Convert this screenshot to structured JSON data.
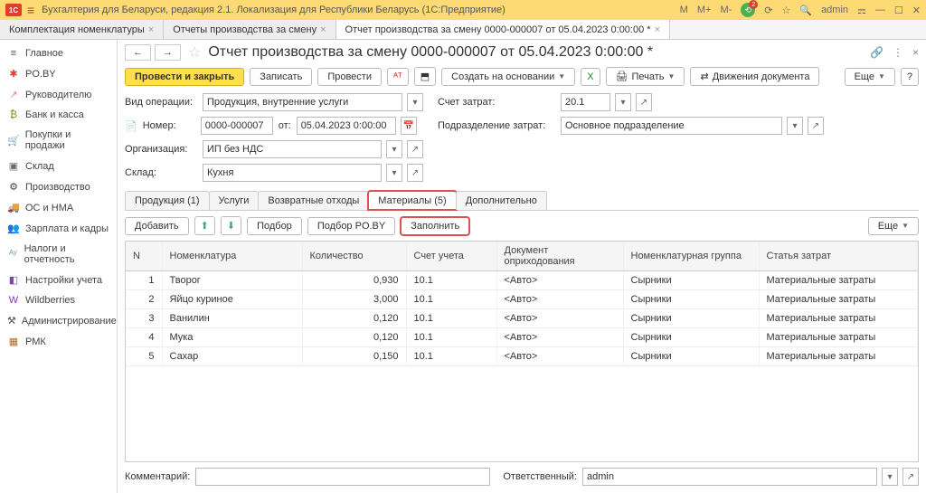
{
  "titlebar": {
    "title": "Бухгалтерия для Беларуси, редакция 2.1. Локализация для Республики Беларусь    (1С:Предприятие)",
    "m": "M",
    "mplus": "M+",
    "mminus": "M-",
    "admin": "admin"
  },
  "tabs": [
    {
      "label": "Комплектация номенклатуры"
    },
    {
      "label": "Отчеты производства за смену"
    },
    {
      "label": "Отчет производства за смену 0000-000007 от 05.04.2023 0:00:00 *"
    }
  ],
  "sidebar": {
    "items": [
      {
        "icon": "≡",
        "label": "Главное",
        "c": "#555"
      },
      {
        "icon": "✱",
        "label": "PO.BY",
        "c": "#e23d2d"
      },
      {
        "icon": "↗",
        "label": "Руководителю",
        "c": "#e07bc0"
      },
      {
        "icon": "₿",
        "label": "Банк и касса",
        "c": "#8a8a00"
      },
      {
        "icon": "🛒",
        "label": "Покупки и продажи",
        "c": "#7b4b1e"
      },
      {
        "icon": "▣",
        "label": "Склад",
        "c": "#6a6a6a"
      },
      {
        "icon": "⚙",
        "label": "Производство",
        "c": "#444"
      },
      {
        "icon": "🚚",
        "label": "ОС и НМА",
        "c": "#444"
      },
      {
        "icon": "👥",
        "label": "Зарплата и кадры",
        "c": "#c76a1e"
      },
      {
        "icon": "ᴬʸ",
        "label": "Налоги и отчетность",
        "c": "#7aa0a0"
      },
      {
        "icon": "◧",
        "label": "Настройки учета",
        "c": "#7a4aa0"
      },
      {
        "icon": "W",
        "label": "Wildberries",
        "c": "#8033b3"
      },
      {
        "icon": "⚒",
        "label": "Администрирование",
        "c": "#555"
      },
      {
        "icon": "▦",
        "label": "РМК",
        "c": "#b36a1e"
      }
    ]
  },
  "doc": {
    "title": "Отчет производства за смену 0000-000007 от 05.04.2023 0:00:00 *",
    "toolbar": {
      "provesti_zakryt": "Провести и закрыть",
      "zapisat": "Записать",
      "provesti": "Провести",
      "sozdat": "Создать на основании",
      "pechat": "Печать",
      "dvizheniya": "Движения документа",
      "eshche": "Еще"
    },
    "form": {
      "vid_label": "Вид операции:",
      "vid_value": "Продукция, внутренние услуги",
      "schet_label": "Счет затрат:",
      "schet_value": "20.1",
      "nomer_label": "Номер:",
      "nomer_value": "0000-000007",
      "ot_label": "от:",
      "ot_value": "05.04.2023  0:00:00",
      "podr_label": "Подразделение затрат:",
      "podr_value": "Основное подразделение",
      "org_label": "Организация:",
      "org_value": "ИП без НДС",
      "sklad_label": "Склад:",
      "sklad_value": "Кухня"
    },
    "doctabs": [
      {
        "label": "Продукция (1)"
      },
      {
        "label": "Услуги"
      },
      {
        "label": "Возвратные отходы"
      },
      {
        "label": "Материалы (5)"
      },
      {
        "label": "Дополнительно"
      }
    ],
    "subtoolbar": {
      "dobavit": "Добавить",
      "podbor": "Подбор",
      "podbor_poby": "Подбор PO.BY",
      "zapolnit": "Заполнить",
      "eshche": "Еще"
    },
    "table": {
      "headers": {
        "n": "N",
        "nom": "Номенклатура",
        "kol": "Количество",
        "schet": "Счет учета",
        "dok": "Документ оприходования",
        "grp": "Номенклатурная группа",
        "stat": "Статья затрат"
      },
      "rows": [
        {
          "n": "1",
          "nom": "Творог",
          "kol": "0,930",
          "schet": "10.1",
          "dok": "<Авто>",
          "grp": "Сырники",
          "stat": "Материальные затраты"
        },
        {
          "n": "2",
          "nom": "Яйцо куриное",
          "kol": "3,000",
          "schet": "10.1",
          "dok": "<Авто>",
          "grp": "Сырники",
          "stat": "Материальные затраты"
        },
        {
          "n": "3",
          "nom": "Ванилин",
          "kol": "0,120",
          "schet": "10.1",
          "dok": "<Авто>",
          "grp": "Сырники",
          "stat": "Материальные затраты"
        },
        {
          "n": "4",
          "nom": "Мука",
          "kol": "0,120",
          "schet": "10.1",
          "dok": "<Авто>",
          "grp": "Сырники",
          "stat": "Материальные затраты"
        },
        {
          "n": "5",
          "nom": "Сахар",
          "kol": "0,150",
          "schet": "10.1",
          "dok": "<Авто>",
          "grp": "Сырники",
          "stat": "Материальные затраты"
        }
      ]
    },
    "footer": {
      "comment_label": "Комментарий:",
      "comment_value": "",
      "resp_label": "Ответственный:",
      "resp_value": "admin"
    }
  }
}
